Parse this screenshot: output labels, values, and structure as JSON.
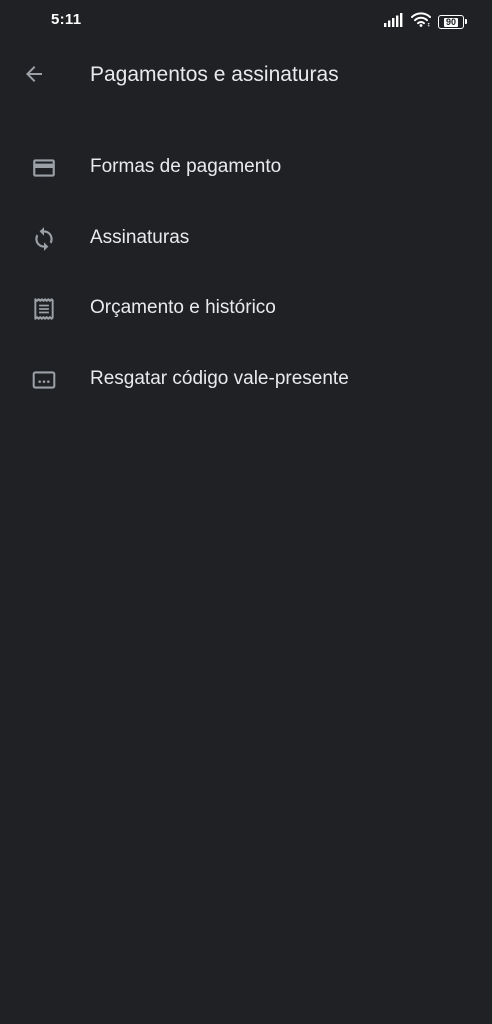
{
  "status_bar": {
    "time": "5:11",
    "battery": "90",
    "icons": [
      "signal-icon",
      "wifi-icon",
      "battery-icon"
    ]
  },
  "header": {
    "title": "Pagamentos e assinaturas",
    "back_icon": "arrow-back-icon"
  },
  "menu": {
    "items": [
      {
        "label": "Formas de pagamento",
        "icon": "credit-card-icon"
      },
      {
        "label": "Assinaturas",
        "icon": "sync-icon"
      },
      {
        "label": "Orçamento e histórico",
        "icon": "receipt-icon"
      },
      {
        "label": "Resgatar código vale-presente",
        "icon": "redeem-code-icon"
      }
    ]
  },
  "colors": {
    "background": "#202124",
    "text": "#e8eaed",
    "icon": "#9aa0a6"
  }
}
